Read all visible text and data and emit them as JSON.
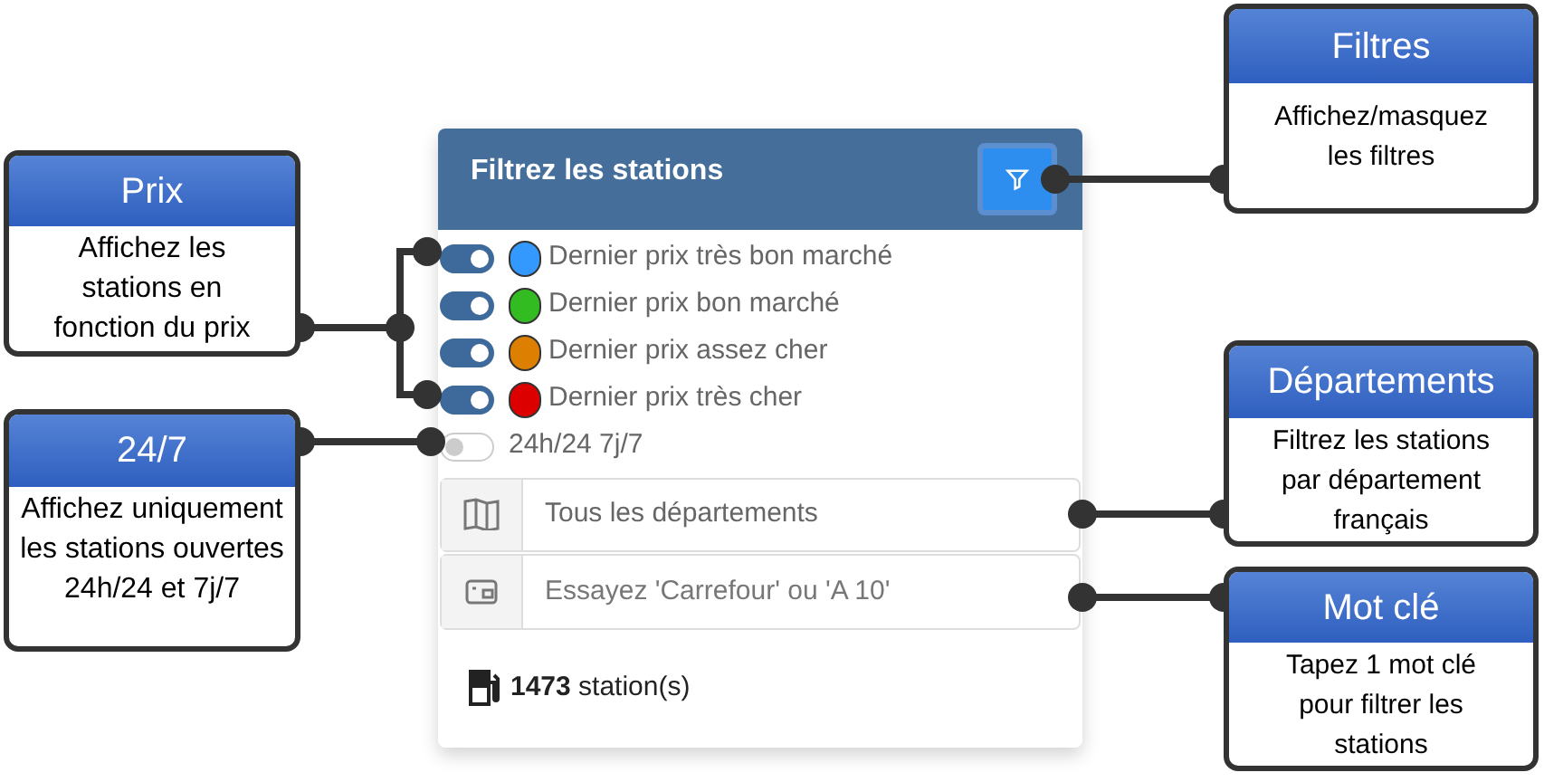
{
  "panel": {
    "title": "Filtrez les stations",
    "filters": [
      {
        "label": "Dernier prix très bon marché",
        "on": true,
        "color": "#3399ff"
      },
      {
        "label": "Dernier prix bon marché",
        "on": true,
        "color": "#33bb22"
      },
      {
        "label": "Dernier prix assez cher",
        "on": true,
        "color": "#dd7f00"
      },
      {
        "label": "Dernier prix très cher",
        "on": true,
        "color": "#dd0000"
      }
    ],
    "open_24_7": {
      "label": "24h/24 7j/7",
      "on": false
    },
    "department_field": {
      "value": "Tous les départements"
    },
    "keyword_field": {
      "placeholder": "Essayez 'Carrefour' ou 'A 10'"
    },
    "count": "**1473** station(s)"
  },
  "callouts": [
    {
      "title": "Filtres",
      "text": "Affichez/masquez les filtres"
    },
    {
      "title": "Prix",
      "text": "Affichez les stations en fonction du prix"
    },
    {
      "title": "24/7",
      "text": "Affichez uniquement les stations ouvertes 24h/24 et 7j/7"
    },
    {
      "title": "Départements",
      "text": "Filtrez les stations par département français"
    },
    {
      "title": "Mot clé",
      "text": "Tapez 1 mot clé pour filtrer les stations"
    }
  ]
}
